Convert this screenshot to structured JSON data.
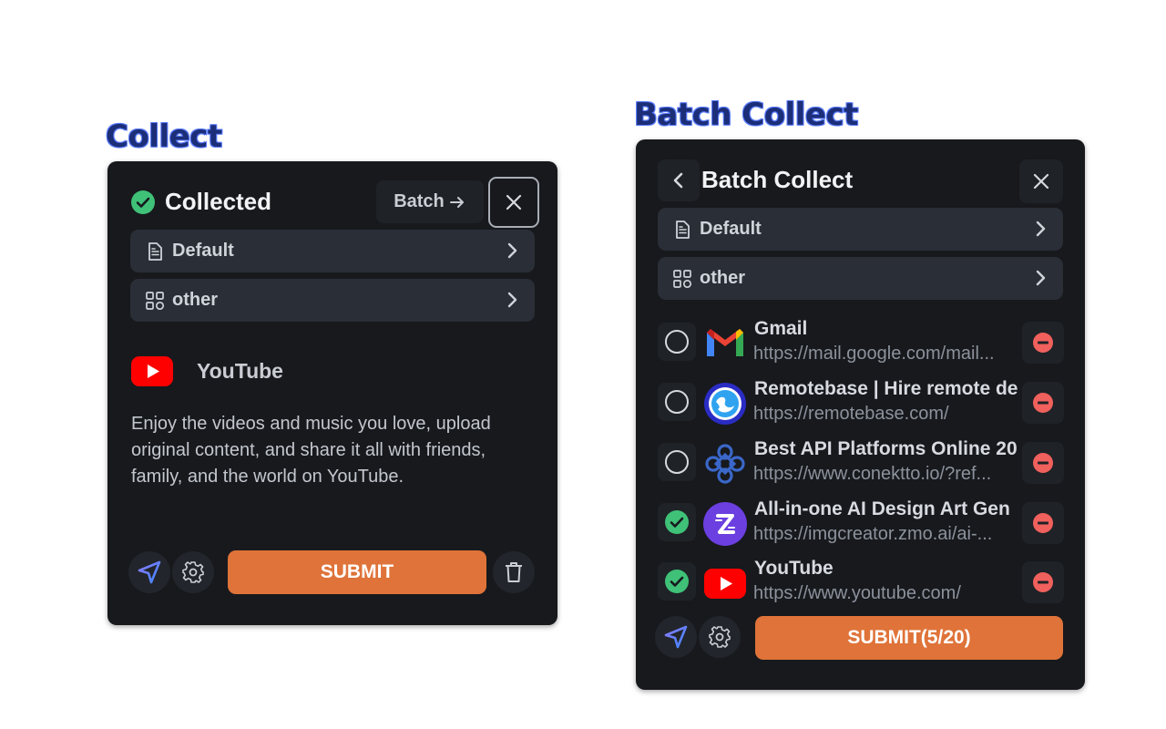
{
  "headings": {
    "collect": "Collect",
    "batch": "Batch Collect"
  },
  "collect_panel": {
    "status_title": "Collected",
    "batch_label": "Batch",
    "folder_label": "Default",
    "category_label": "other",
    "site_name": "YouTube",
    "site_description": "Enjoy the videos and music you love, upload original content, and share it all with friends, family, and the world on YouTube.",
    "submit_label": "SUBMIT"
  },
  "batch_panel": {
    "title": "Batch Collect",
    "folder_label": "Default",
    "category_label": "other",
    "items": [
      {
        "title": "Gmail",
        "url": "https://mail.google.com/mail...",
        "checked": false,
        "icon": "gmail-icon"
      },
      {
        "title": "Remotebase | Hire remote de",
        "url": "https://remotebase.com/",
        "checked": false,
        "icon": "remotebase-icon"
      },
      {
        "title": "Best API Platforms Online 20",
        "url": "https://www.conektto.io/?ref...",
        "checked": false,
        "icon": "conektto-icon"
      },
      {
        "title": "All-in-one AI Design Art Gen",
        "url": "https://imgcreator.zmo.ai/ai-...",
        "checked": true,
        "icon": "zmo-icon"
      },
      {
        "title": "YouTube",
        "url": "https://www.youtube.com/",
        "checked": true,
        "icon": "youtube-icon"
      }
    ],
    "submit_label": "SUBMIT(5/20)"
  },
  "colors": {
    "accent": "#df7339",
    "check": "#3fc178",
    "remove": "#f0605c",
    "panel": "#17191d",
    "heading": "#1c2e78"
  }
}
